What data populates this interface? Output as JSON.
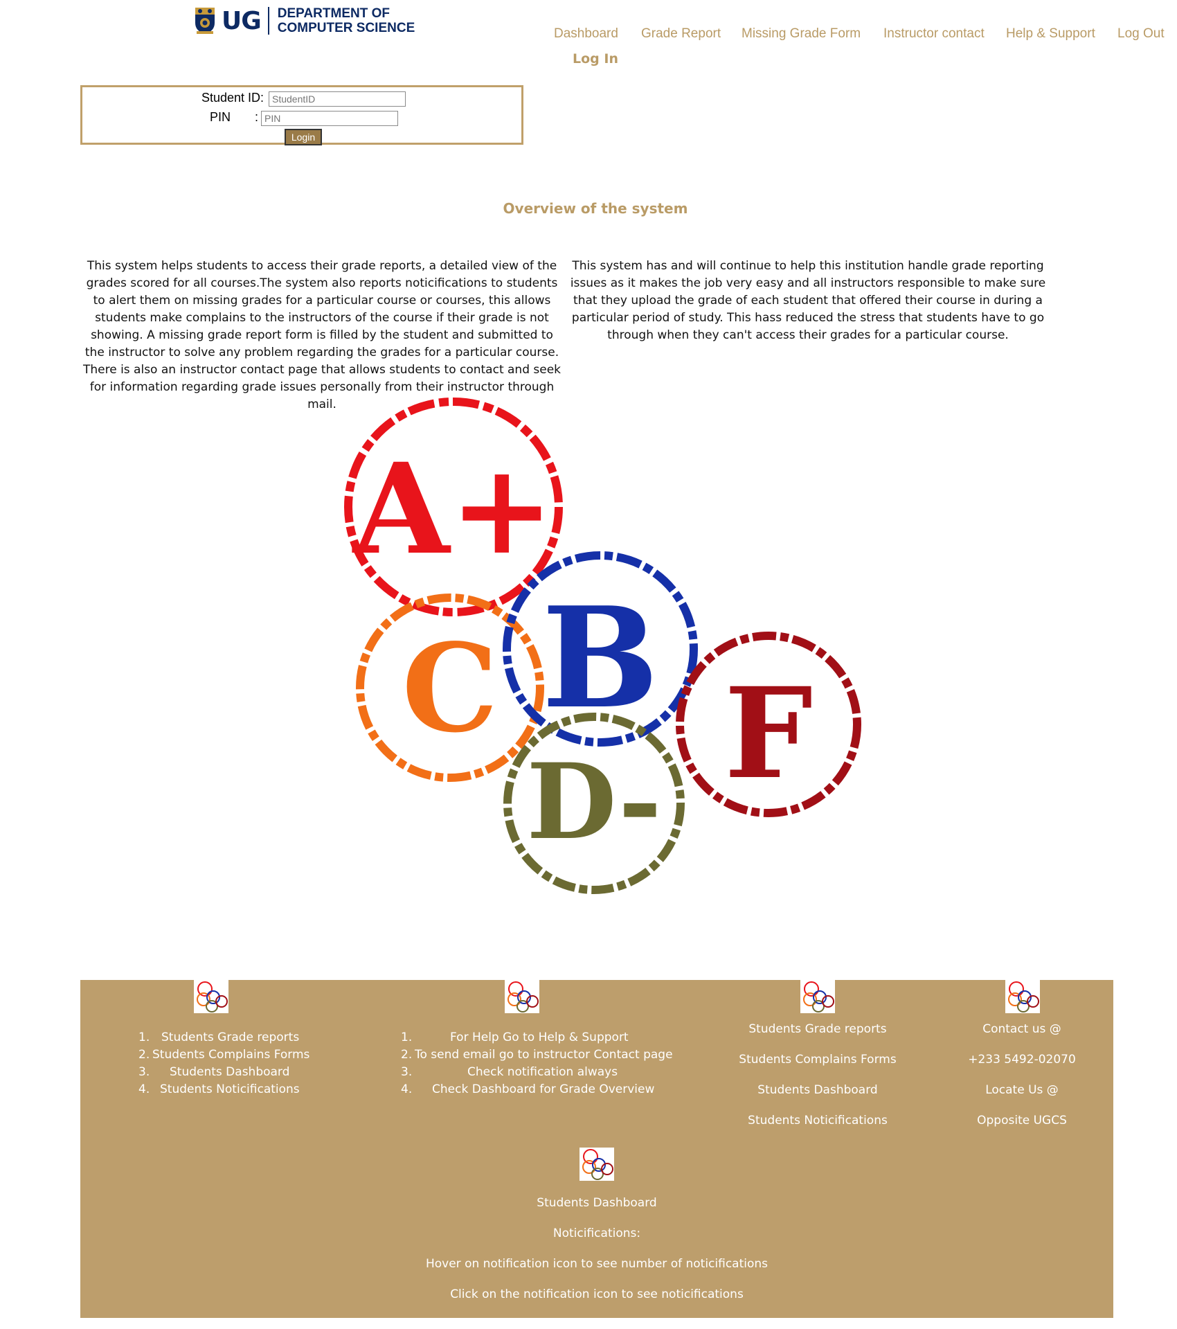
{
  "header": {
    "logo_text": "UG",
    "department_line1": "DEPARTMENT OF",
    "department_line2": "COMPUTER SCIENCE"
  },
  "nav": {
    "items": [
      "Dashboard",
      "Grade Report",
      "Missing Grade Form",
      "Instructor contact",
      "Help & Support",
      "Log Out"
    ],
    "login_title": "Log In"
  },
  "login": {
    "student_id_label": "Student ID:",
    "student_id_placeholder": "StudentID",
    "pin_label": "PIN",
    "pin_colon": ":",
    "pin_placeholder": "PIN",
    "button_label": "Login"
  },
  "overview": {
    "title": "Overview of the system",
    "left_text": "This system helps students to access their grade reports, a detailed view of the grades scored for all courses.The system also reports noticifications to students to alert them on missing grades for a particular course or courses, this allows students make complains to the instructors of the course if their grade is not showing. A missing grade report form is filled by the student and submitted to the instructor to solve any problem regarding the grades for a particular course. There is also an instructor contact page that allows students to contact and seek for information regarding grade issues personally from their instructor through mail.",
    "right_text": "This system has and will continue to help this institution handle grade reporting issues as it makes the job very easy and all instructors responsible to make sure that they upload the grade of each student that offered their course in during a particular period of study. This hass reduced the stress that students have to go through when they can't access their grades for a particular course."
  },
  "grades_image": {
    "labels": [
      "A+",
      "B",
      "C",
      "D-",
      "F"
    ],
    "colors": {
      "a": "#e8141b",
      "b": "#1530a8",
      "c": "#f26f17",
      "d": "#6b6a32",
      "f": "#a10f16"
    }
  },
  "footer": {
    "col1": [
      {
        "num": "1.",
        "text": "Students Grade reports"
      },
      {
        "num": "2.",
        "text": "Students Complains Forms"
      },
      {
        "num": "3.",
        "text": "Students Dashboard"
      },
      {
        "num": "4.",
        "text": "Students Noticifications"
      }
    ],
    "col2": [
      {
        "num": "1.",
        "text": "For Help Go to Help & Support"
      },
      {
        "num": "2.",
        "text": "To send email go to instructor Contact page"
      },
      {
        "num": "3.",
        "text": "Check notification always"
      },
      {
        "num": "4.",
        "text": "Check Dashboard for Grade Overview"
      }
    ],
    "col3": [
      "Students Grade reports",
      "Students Complains Forms",
      "Students Dashboard",
      "Students Noticifications"
    ],
    "col4": [
      "Contact us @",
      "+233 5492-02070",
      "Locate Us @",
      "Opposite UGCS"
    ],
    "bottom": [
      "Students Dashboard",
      "Noticifications:",
      "Hover on notification icon to see number of noticifications",
      "Click on the notification icon to see noticifications"
    ]
  }
}
